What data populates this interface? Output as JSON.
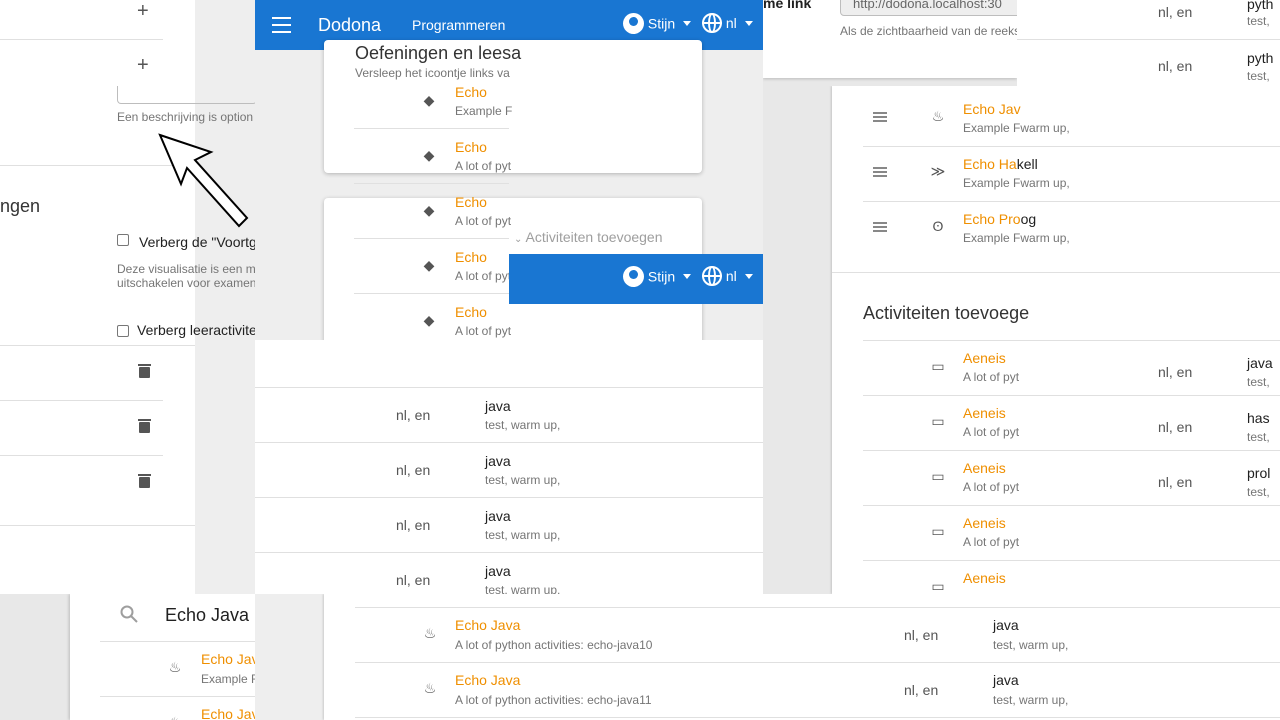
{
  "left_panel": {
    "plus_symbol": "+",
    "description_hint": "Een beschrijving is option",
    "section_title": "ngen",
    "hide_progress_label": "Verberg de \"Voortg",
    "visualization_note_1": "Deze visualisatie is een m",
    "visualization_note_2": "uitschakelen voor examen",
    "hide_activities_label": "Verberg leeractivite"
  },
  "appbar": {
    "menu_icon": "menu-icon",
    "brand": "Dodona",
    "nav_link": "Programmeren",
    "user": "Stijn",
    "lang": "nl"
  },
  "center_top": {
    "section_title": "Oefeningen en leesa",
    "subtitle": "Versleep het icoontje links va",
    "items": [
      {
        "title": "Echo",
        "sub": "Example F"
      },
      {
        "title": "Echo",
        "sub": "A lot of pyt"
      },
      {
        "title": "Echo",
        "sub": "A lot of pyt"
      },
      {
        "title": "Echo",
        "sub": "A lot of pyt"
      },
      {
        "title": "Echo",
        "sub": "A lot of pyt"
      }
    ],
    "add_activities": "Activiteiten toevoegen"
  },
  "top_right": {
    "link_label": "me link",
    "link_value": "http://dodona.localhost:30",
    "visibility_note": "Als de zichtbaarheid van de reeks"
  },
  "far_right_top": {
    "rows": [
      {
        "langs": "nl, en",
        "prog": "pyth",
        "tags": "test,"
      },
      {
        "langs": "nl, en",
        "prog": "pyth",
        "tags": "test,"
      }
    ]
  },
  "right_mid": {
    "items": [
      {
        "title": "Echo Jav",
        "sub": "Example Fwarm up,"
      },
      {
        "title": "Echo Ha",
        "title_rest": "kell",
        "sub": "Example Fwarm up,"
      },
      {
        "title": "Echo Pro",
        "title_rest": "og",
        "sub": "Example Fwarm up,"
      }
    ],
    "add_title": "Activiteiten toevoege",
    "activities": [
      {
        "title": "Aeneis",
        "sub": "A lot of pyt",
        "langs": "nl, en",
        "prog": "java",
        "tags": "test,"
      },
      {
        "title": "Aeneis",
        "sub": "A lot of pyt",
        "langs": "nl, en",
        "prog": "has",
        "tags": "test,"
      },
      {
        "title": "Aeneis",
        "sub": "A lot of pyt",
        "langs": "nl, en",
        "prog": "prol",
        "tags": "test,"
      },
      {
        "title": "Aeneis",
        "sub": "A lot of pyt"
      },
      {
        "title": "Aeneis",
        "sub": ""
      }
    ]
  },
  "middle_table": {
    "rows": [
      {
        "langs": "nl, en",
        "prog": "java",
        "tags": "test, warm up,"
      },
      {
        "langs": "nl, en",
        "prog": "java",
        "tags": "test, warm up,"
      },
      {
        "langs": "nl, en",
        "prog": "java",
        "tags": "test, warm up,"
      },
      {
        "langs": "nl, en",
        "prog": "java",
        "tags": "test, warm up,"
      }
    ]
  },
  "bottom_left": {
    "search_value": "Echo Java",
    "items": [
      {
        "title": "Echo Jav",
        "sub": "Example F"
      },
      {
        "title": "Echo Jav",
        "sub": ""
      }
    ]
  },
  "bottom_center": {
    "rows": [
      {
        "title": "Echo Java",
        "sub": "A lot of python activities: echo-java10",
        "langs": "nl, en",
        "prog": "java",
        "tags": "test, warm up,"
      },
      {
        "title": "Echo Java",
        "sub": "A lot of python activities: echo-java11",
        "langs": "nl, en",
        "prog": "java",
        "tags": "test, warm up,"
      }
    ]
  },
  "colors": {
    "accent": "#ef8f00",
    "primary": "#1976d2"
  }
}
